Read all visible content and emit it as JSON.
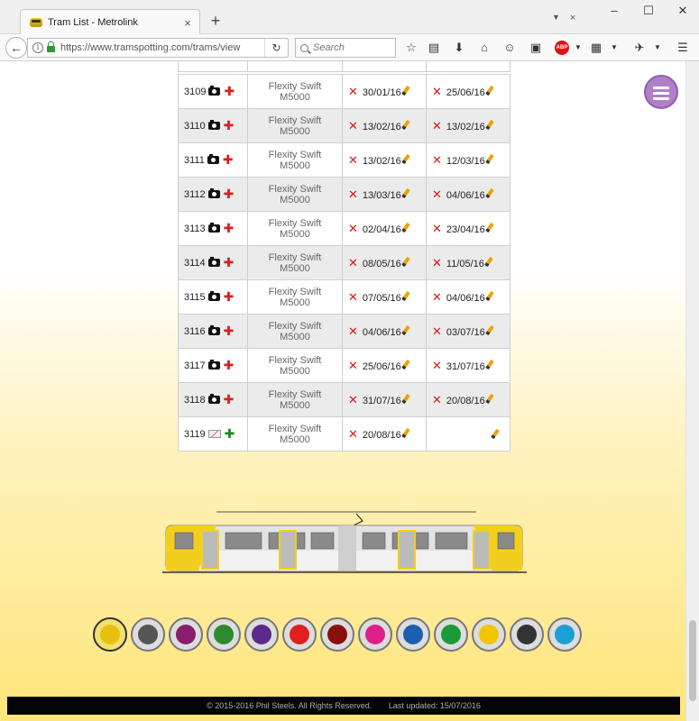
{
  "browser": {
    "tab_title": "Tram List - Metrolink",
    "tab_close": "×",
    "new_tab": "+",
    "url": "https://www.tramspotting.com/trams/view",
    "search_placeholder": "Search",
    "window_minimize": "–",
    "window_maximize": "☐",
    "window_close": "✕"
  },
  "trams": [
    {
      "number": "3109",
      "photo": true,
      "model": "Flexity Swift M5000",
      "first_date": "30/01/16",
      "last_date": "25/06/16"
    },
    {
      "number": "3110",
      "photo": true,
      "model": "Flexity Swift M5000",
      "first_date": "13/02/16",
      "last_date": "13/02/16"
    },
    {
      "number": "3111",
      "photo": true,
      "model": "Flexity Swift M5000",
      "first_date": "13/02/16",
      "last_date": "12/03/16"
    },
    {
      "number": "3112",
      "photo": true,
      "model": "Flexity Swift M5000",
      "first_date": "13/03/16",
      "last_date": "04/06/16"
    },
    {
      "number": "3113",
      "photo": true,
      "model": "Flexity Swift M5000",
      "first_date": "02/04/16",
      "last_date": "23/04/16"
    },
    {
      "number": "3114",
      "photo": true,
      "model": "Flexity Swift M5000",
      "first_date": "08/05/16",
      "last_date": "11/05/16"
    },
    {
      "number": "3115",
      "photo": true,
      "model": "Flexity Swift M5000",
      "first_date": "07/05/16",
      "last_date": "04/06/16"
    },
    {
      "number": "3116",
      "photo": true,
      "model": "Flexity Swift M5000",
      "first_date": "04/06/16",
      "last_date": "03/07/16"
    },
    {
      "number": "3117",
      "photo": true,
      "model": "Flexity Swift M5000",
      "first_date": "25/06/16",
      "last_date": "31/07/16"
    },
    {
      "number": "3118",
      "photo": true,
      "model": "Flexity Swift M5000",
      "first_date": "31/07/16",
      "last_date": "20/08/16"
    },
    {
      "number": "3119",
      "photo": false,
      "model": "Flexity Swift M5000",
      "first_date": "20/08/16",
      "last_date": ""
    }
  ],
  "network_logos": [
    {
      "name": "tramspotting",
      "color": "#e8c010"
    },
    {
      "name": "sheffield",
      "color": "#555555"
    },
    {
      "name": "blackpool",
      "color": "#8a1e6e"
    },
    {
      "name": "nottingham",
      "color": "#2f8a2f"
    },
    {
      "name": "midland-metro",
      "color": "#5b2a8a"
    },
    {
      "name": "croydon",
      "color": "#e02020"
    },
    {
      "name": "edinburgh",
      "color": "#8a1010"
    },
    {
      "name": "tyne-and-wear",
      "color": "#e0208a"
    },
    {
      "name": "glasgow",
      "color": "#1c5fb0"
    },
    {
      "name": "tramlink",
      "color": "#1b9a3a"
    },
    {
      "name": "metrolink",
      "color": "#f2c500"
    },
    {
      "name": "nexus",
      "color": "#333333"
    },
    {
      "name": "dlr",
      "color": "#1c9ed6"
    }
  ],
  "footer": {
    "copyright": "© 2015-2016 Phil Steels. All Rights Reserved.",
    "updated": "Last updated: 15/07/2016"
  }
}
